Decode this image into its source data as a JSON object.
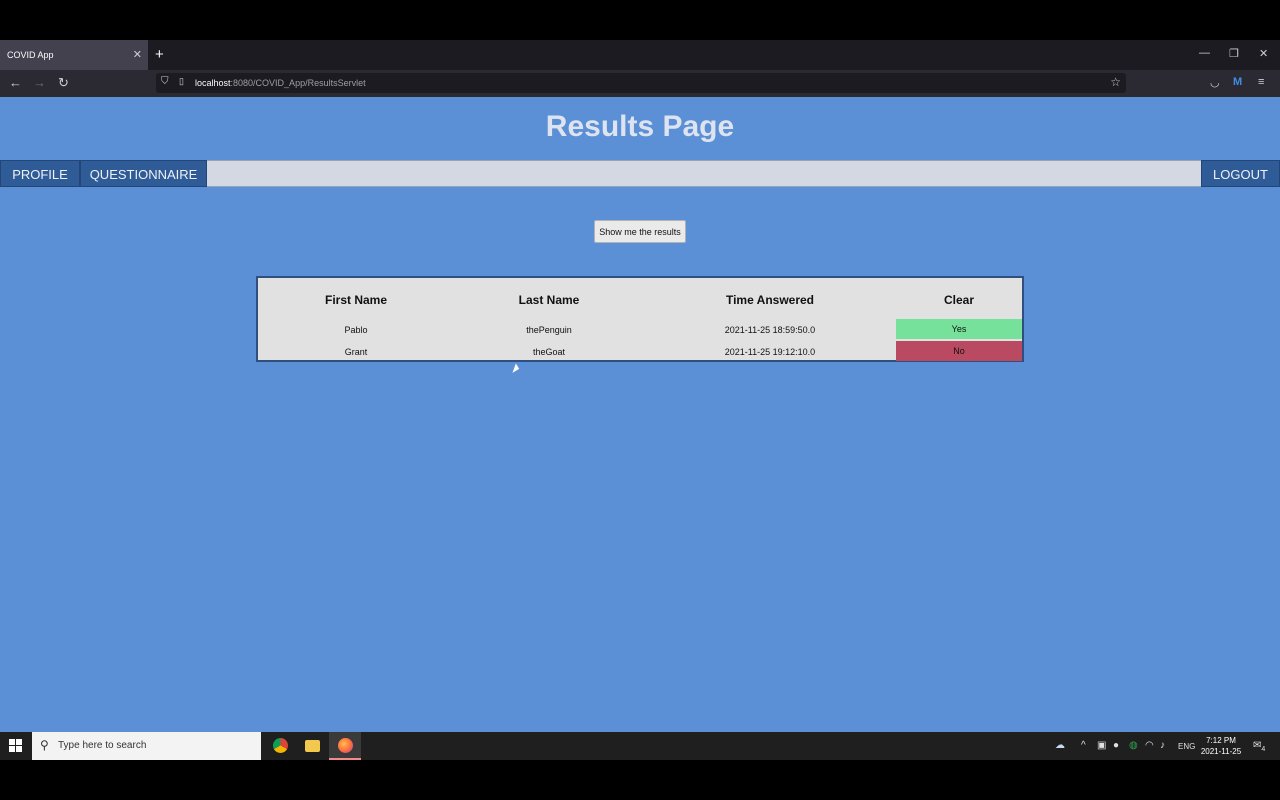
{
  "browser": {
    "tab_title": "COVID App",
    "tab_close": "✕",
    "new_tab": "+",
    "url_host": "localhost",
    "url_rest": ":8080/COVID_App/ResultsServlet"
  },
  "page": {
    "title": "Results Page",
    "menu": {
      "profile": "PROFILE",
      "questionnaire": "QUESTIONNAIRE",
      "logout": "LOGOUT"
    },
    "show_button": "Show me the results"
  },
  "results": {
    "headers": [
      "First Name",
      "Last Name",
      "Time Answered",
      "Clear"
    ],
    "rows": [
      {
        "first": "Pablo",
        "last": "thePenguin",
        "time": "2021-11-25 18:59:50.0",
        "clear": "Yes"
      },
      {
        "first": "Grant",
        "last": "theGoat",
        "time": "2021-11-25 19:12:10.0",
        "clear": "No"
      }
    ],
    "colors": {
      "yes": "#76e19a",
      "no": "#b94a61",
      "page_bg": "#5b8fd6",
      "menu_bg": "#2f5b96"
    }
  },
  "taskbar": {
    "search_placeholder": "Type here to search",
    "lang": "ENG",
    "time": "7:12 PM",
    "date": "2021-11-25",
    "notifications": "4"
  },
  "icons": {
    "back": "arrow-left-icon",
    "forward": "arrow-right-icon",
    "reload": "reload-icon",
    "bookmark": "star-icon",
    "pocket": "pocket-icon",
    "menu": "hamburger-icon",
    "start": "windows-start-icon",
    "chrome": "chrome-icon",
    "explorer": "file-explorer-icon",
    "firefox": "firefox-icon"
  }
}
